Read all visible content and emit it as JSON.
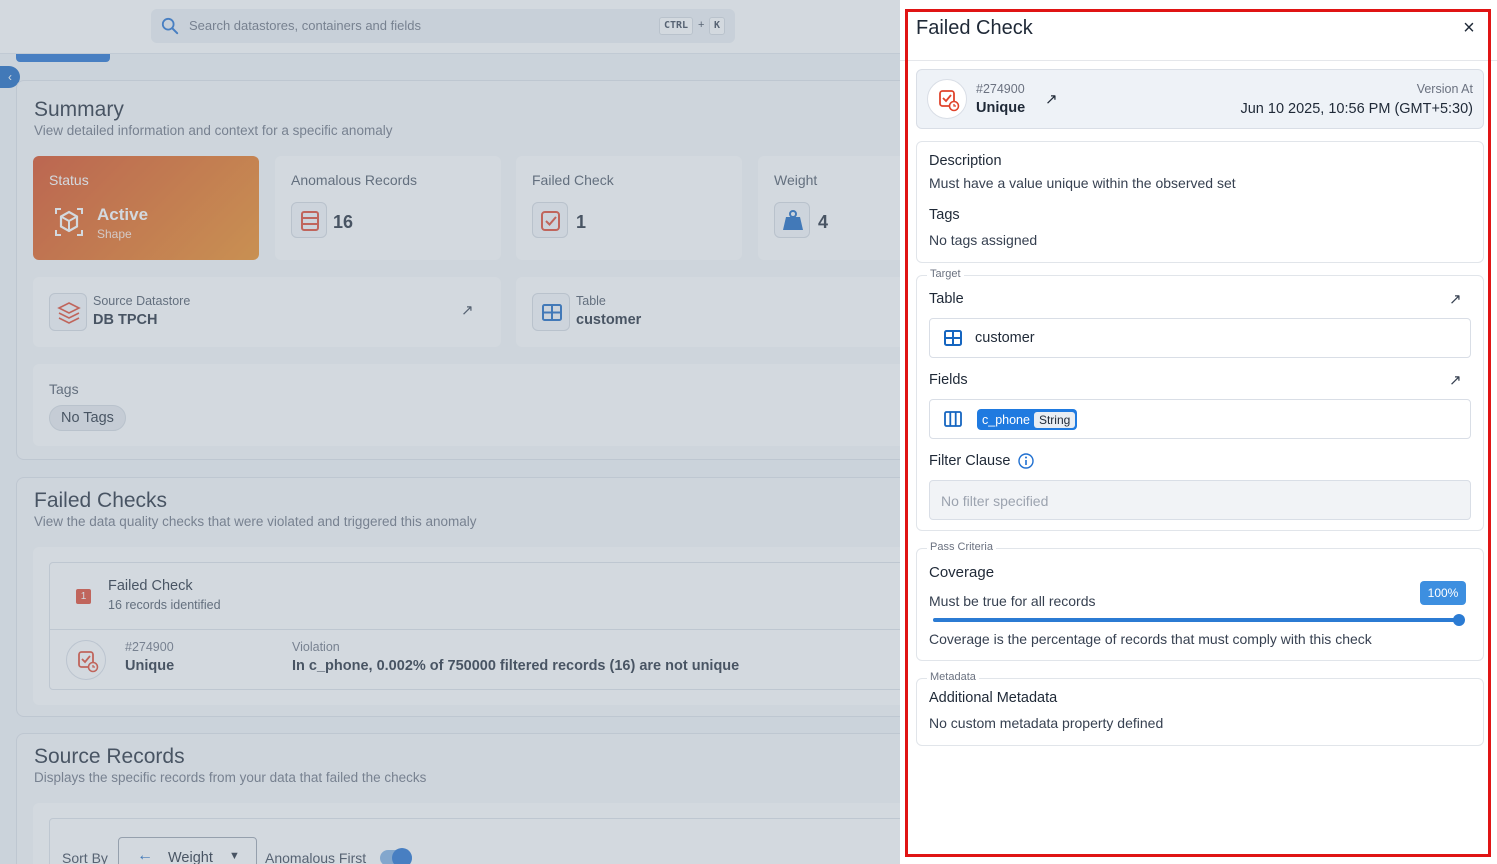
{
  "search": {
    "placeholder": "Search datastores, containers and fields",
    "key1": "CTRL",
    "plus": "+",
    "key2": "K"
  },
  "summary": {
    "title": "Summary",
    "subtitle": "View detailed information and context for a specific anomaly",
    "status": {
      "label": "Status",
      "value": "Active",
      "sub": "Shape"
    },
    "anomalous_records": {
      "label": "Anomalous Records",
      "value": "16"
    },
    "failed_check": {
      "label": "Failed Check",
      "value": "1"
    },
    "weight": {
      "label": "Weight",
      "value": "4"
    },
    "source_datastore": {
      "label": "Source Datastore",
      "value": "DB TPCH"
    },
    "table": {
      "label": "Table",
      "value": "customer"
    },
    "tags": {
      "label": "Tags",
      "chip": "No Tags"
    }
  },
  "failed_checks": {
    "title": "Failed Checks",
    "subtitle": "View the data quality checks that were violated and triggered this anomaly",
    "group": {
      "badge": "1",
      "title": "Failed Check",
      "sub": "16 records identified"
    },
    "row": {
      "id": "#274900",
      "rule": "Unique",
      "violation_label": "Violation",
      "violation_text": "In c_phone, 0.002% of 750000 filtered records (16) are not unique"
    }
  },
  "source_records": {
    "title": "Source Records",
    "subtitle": "Displays the specific records from your data that failed the checks",
    "sort_label": "Sort By",
    "sort_value": "Weight",
    "anomalous_first": "Anomalous First"
  },
  "drawer": {
    "title": "Failed Check",
    "close": "×",
    "check_id": "#274900",
    "rule": "Unique",
    "version_label": "Version At",
    "version_value": "Jun 10 2025, 10:56 PM (GMT+5:30)",
    "description_label": "Description",
    "description": "Must have a value unique within the observed set",
    "tags_label": "Tags",
    "tags_value": "No tags assigned",
    "target_legend": "Target",
    "table_label": "Table",
    "table_value": "customer",
    "fields_label": "Fields",
    "field_name": "c_phone",
    "field_type": "String",
    "filter_label": "Filter Clause",
    "filter_placeholder": "No filter specified",
    "pass_legend": "Pass Criteria",
    "coverage_label": "Coverage",
    "coverage_text": "Must be true for all records",
    "coverage_pct_label": "100%",
    "coverage_fraction": 1.0,
    "coverage_note": "Coverage is the percentage of records that must comply with this check",
    "metadata_legend": "Metadata",
    "metadata_label": "Additional Metadata",
    "metadata_value": "No custom metadata property defined"
  },
  "colors": {
    "accent": "#1f6fd0",
    "status_orange": "#e55d1a",
    "highlight_red": "#e01414",
    "check_red": "#e0442c"
  }
}
